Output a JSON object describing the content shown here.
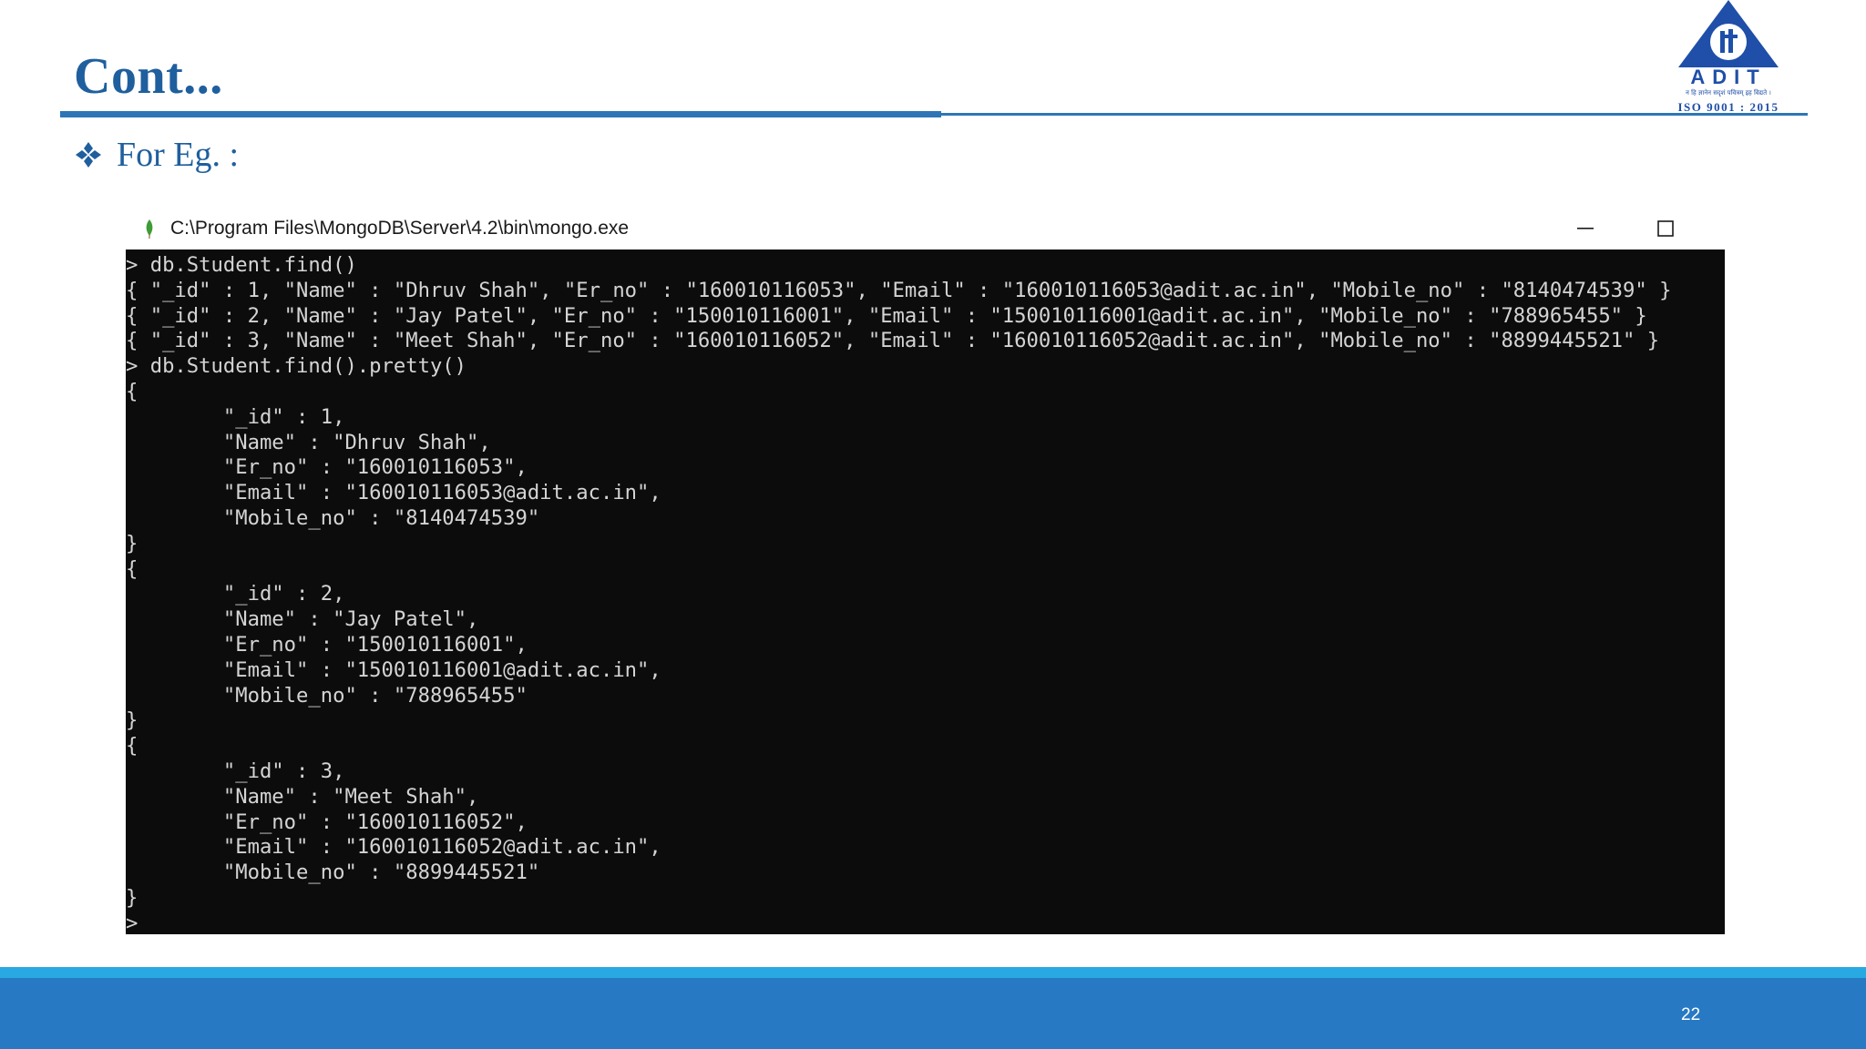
{
  "slide": {
    "title": "Cont...",
    "bullet": "For Eg. :",
    "page_number": "22"
  },
  "logo": {
    "brand": "ADIT",
    "tagline": "न हि ज्ञानेन सदृशं पवित्रम् इह विद्यते ।",
    "certification": "ISO 9001 : 2015"
  },
  "window": {
    "title": "C:\\Program Files\\MongoDB\\Server\\4.2\\bin\\mongo.exe",
    "icon": "mongodb-leaf-icon",
    "controls": [
      "minimize-icon",
      "maximize-icon"
    ]
  },
  "console": {
    "lines": [
      "> db.Student.find()",
      "{ \"_id\" : 1, \"Name\" : \"Dhruv Shah\", \"Er_no\" : \"160010116053\", \"Email\" : \"160010116053@adit.ac.in\", \"Mobile_no\" : \"8140474539\" }",
      "{ \"_id\" : 2, \"Name\" : \"Jay Patel\", \"Er_no\" : \"150010116001\", \"Email\" : \"150010116001@adit.ac.in\", \"Mobile_no\" : \"788965455\" }",
      "{ \"_id\" : 3, \"Name\" : \"Meet Shah\", \"Er_no\" : \"160010116052\", \"Email\" : \"160010116052@adit.ac.in\", \"Mobile_no\" : \"8899445521\" }",
      "> db.Student.find().pretty()",
      "{",
      "        \"_id\" : 1,",
      "        \"Name\" : \"Dhruv Shah\",",
      "        \"Er_no\" : \"160010116053\",",
      "        \"Email\" : \"160010116053@adit.ac.in\",",
      "        \"Mobile_no\" : \"8140474539\"",
      "}",
      "{",
      "        \"_id\" : 2,",
      "        \"Name\" : \"Jay Patel\",",
      "        \"Er_no\" : \"150010116001\",",
      "        \"Email\" : \"150010116001@adit.ac.in\",",
      "        \"Mobile_no\" : \"788965455\"",
      "}",
      "{",
      "        \"_id\" : 3,",
      "        \"Name\" : \"Meet Shah\",",
      "        \"Er_no\" : \"160010116052\",",
      "        \"Email\" : \"160010116052@adit.ac.in\",",
      "        \"Mobile_no\" : \"8899445521\"",
      "}",
      ">"
    ]
  },
  "colors": {
    "title": "#1f5f9e",
    "rule": "#2e75b6",
    "footer_light": "#29a9e1",
    "footer_dark": "#2779c4",
    "console_bg": "#0c0c0c",
    "console_text": "#d4d4d4"
  }
}
